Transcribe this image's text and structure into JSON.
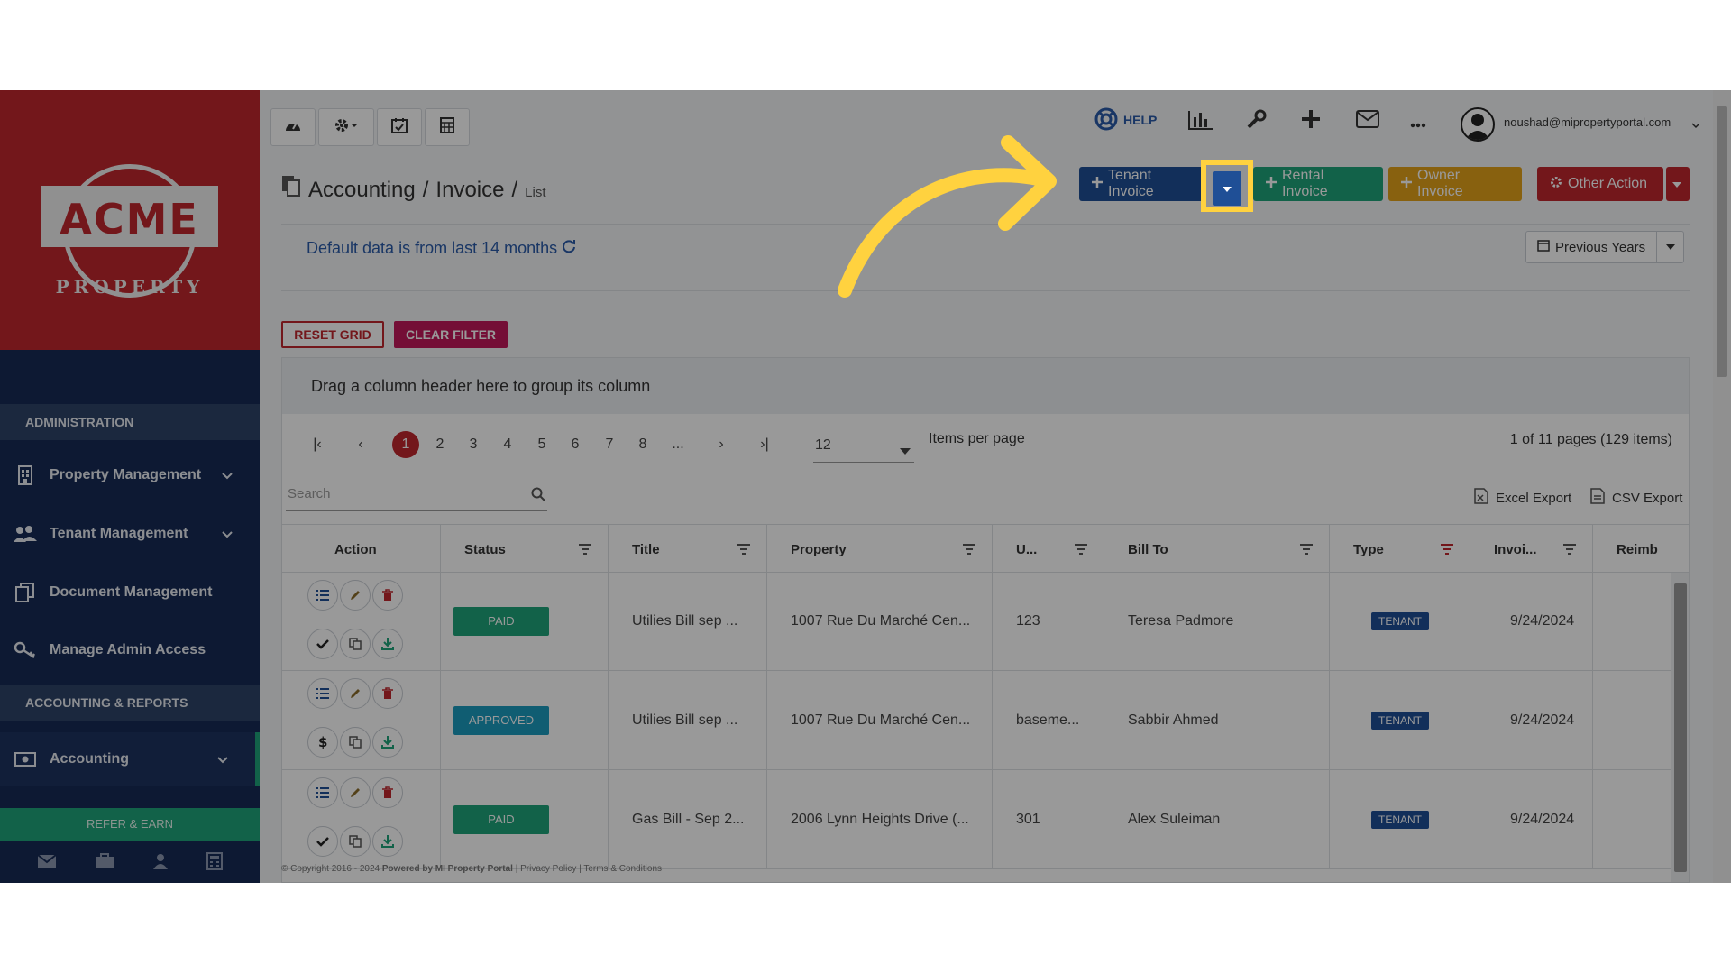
{
  "sidebar": {
    "logo_main": "ACME",
    "logo_sub": "PROPERTY",
    "section_admin": "ADMINISTRATION",
    "items_admin": [
      {
        "label": "Property Management",
        "icon": "building-icon",
        "expandable": true
      },
      {
        "label": "Tenant Management",
        "icon": "users-icon",
        "expandable": true
      },
      {
        "label": "Document Management",
        "icon": "documents-icon",
        "expandable": false
      },
      {
        "label": "Manage Admin Access",
        "icon": "key-icon",
        "expandable": false
      }
    ],
    "section_accounting": "ACCOUNTING & REPORTS",
    "accounting_label": "Accounting",
    "refer_label": "REFER & EARN",
    "footer_icons": [
      "mail-icon",
      "briefcase-icon",
      "user-icon",
      "calculator-icon"
    ]
  },
  "topbar": {
    "tools": [
      "dashboard-icon",
      "settings-icon",
      "calendar-check-icon",
      "calculator-icon"
    ],
    "help_label": "HELP",
    "user_email": "noushad@mipropertyportal.com"
  },
  "page": {
    "crumb_1": "Accounting",
    "crumb_sep": "/",
    "crumb_2": "Invoice",
    "crumb_3": "List",
    "tenant_invoice": "Tenant Invoice",
    "rental_invoice": "Rental Invoice",
    "owner_invoice": "Owner Invoice",
    "other_action": "Other Action",
    "default_note": "Default data is from last 14 months",
    "previous_years": "Previous Years",
    "reset_grid": "RESET GRID",
    "clear_filter": "CLEAR FILTER"
  },
  "grid": {
    "group_hint": "Drag a column header here to group its column",
    "pages": [
      "1",
      "2",
      "3",
      "4",
      "5",
      "6",
      "7",
      "8",
      "..."
    ],
    "current_page": "1",
    "per_page_value": "12",
    "per_page_label": "Items per page",
    "pager_info": "1 of 11 pages (129 items)",
    "search_placeholder": "Search",
    "excel_export": "Excel Export",
    "csv_export": "CSV Export",
    "columns": [
      "Action",
      "Status",
      "Title",
      "Property",
      "U...",
      "Bill To",
      "Type",
      "Invoi...",
      "Reimb"
    ],
    "rows": [
      {
        "status": "PAID",
        "status_color": "#1fa37a",
        "title": "Utilies Bill sep ...",
        "property": "1007 Rue Du Marché Cen...",
        "unit": "123",
        "bill_to": "Teresa Padmore",
        "type": "TENANT",
        "invoice_date": "9/24/2024"
      },
      {
        "status": "APPROVED",
        "status_color": "#1b9bbf",
        "title": "Utilies Bill sep ...",
        "property": "1007 Rue Du Marché Cen...",
        "unit": "baseme...",
        "bill_to": "Sabbir Ahmed",
        "type": "TENANT",
        "invoice_date": "9/24/2024"
      },
      {
        "status": "PAID",
        "status_color": "#1fa37a",
        "title": "Gas Bill - Sep 2...",
        "property": "2006 Lynn Heights Drive (...",
        "unit": "301",
        "bill_to": "Alex Suleiman",
        "type": "TENANT",
        "invoice_date": "9/24/2024"
      }
    ]
  },
  "footer": {
    "copyright": "© Copyright 2016 - 2024",
    "powered": "Powered by MI Property Portal",
    "privacy": "Privacy Policy",
    "terms": "Terms & Conditions"
  },
  "colors": {
    "brand_red": "#c0272d",
    "sidebar_navy": "#162a55",
    "primary_blue": "#1f4f96",
    "green": "#1fa37a",
    "orange": "#e3a21a",
    "highlight_yellow": "#ffd23f"
  }
}
